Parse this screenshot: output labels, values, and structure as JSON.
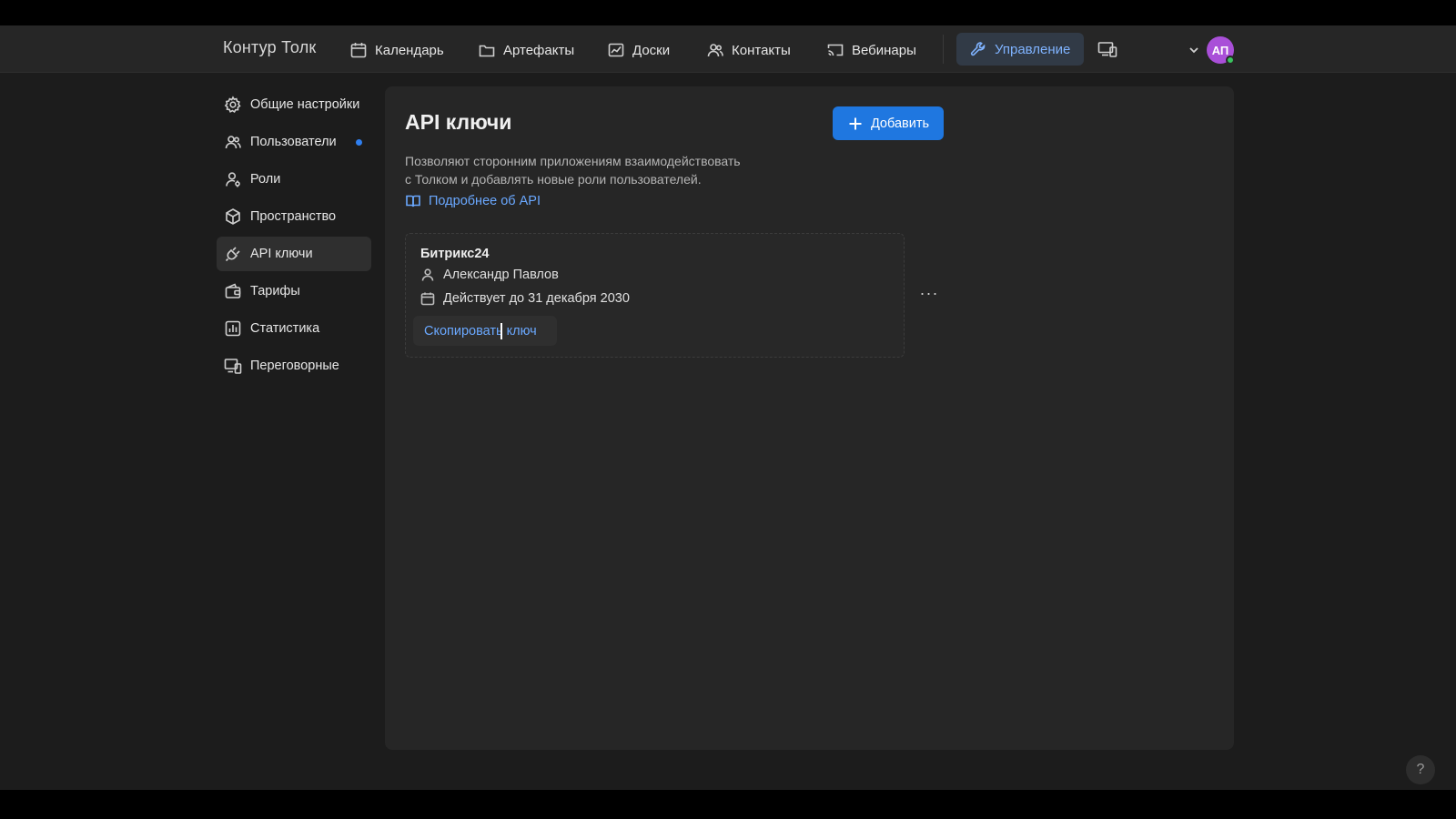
{
  "header": {
    "brand": "Контур Толк",
    "nav": [
      {
        "label": "Календарь",
        "icon": "calendar-icon"
      },
      {
        "label": "Артефакты",
        "icon": "folder-icon"
      },
      {
        "label": "Доски",
        "icon": "board-icon"
      },
      {
        "label": "Контакты",
        "icon": "contacts-icon"
      },
      {
        "label": "Вебинары",
        "icon": "cast-icon"
      }
    ],
    "active_nav": {
      "label": "Управление",
      "icon": "wrench-icon"
    },
    "avatar_initials": "АП"
  },
  "sidebar": {
    "items": [
      {
        "label": "Общие настройки",
        "icon": "gear-icon"
      },
      {
        "label": "Пользователи",
        "icon": "users-icon",
        "has_dot": true
      },
      {
        "label": "Роли",
        "icon": "role-icon"
      },
      {
        "label": "Пространство",
        "icon": "cube-icon"
      },
      {
        "label": "API ключи",
        "icon": "plug-icon",
        "active": true
      },
      {
        "label": "Тарифы",
        "icon": "wallet-icon"
      },
      {
        "label": "Статистика",
        "icon": "chart-icon"
      },
      {
        "label": "Переговорные",
        "icon": "devices-icon"
      }
    ]
  },
  "main": {
    "title": "API ключи",
    "add_button": "Добавить",
    "description_line1": "Позволяют сторонним приложениям взаимодействовать",
    "description_line2": "с Толком и добавлять новые роли пользователей.",
    "api_link": "Подробнее об API",
    "card": {
      "name": "Битрикс24",
      "owner": "Александр Павлов",
      "valid_until": "Действует до 31 декабря 2030",
      "copy_button": "Скопировать ключ"
    },
    "more_label": "···"
  },
  "help_label": "?",
  "colors": {
    "accent": "#1f77e0",
    "link": "#6aa8ff",
    "avatar": "#a94fd8",
    "online": "#3ac25e"
  }
}
